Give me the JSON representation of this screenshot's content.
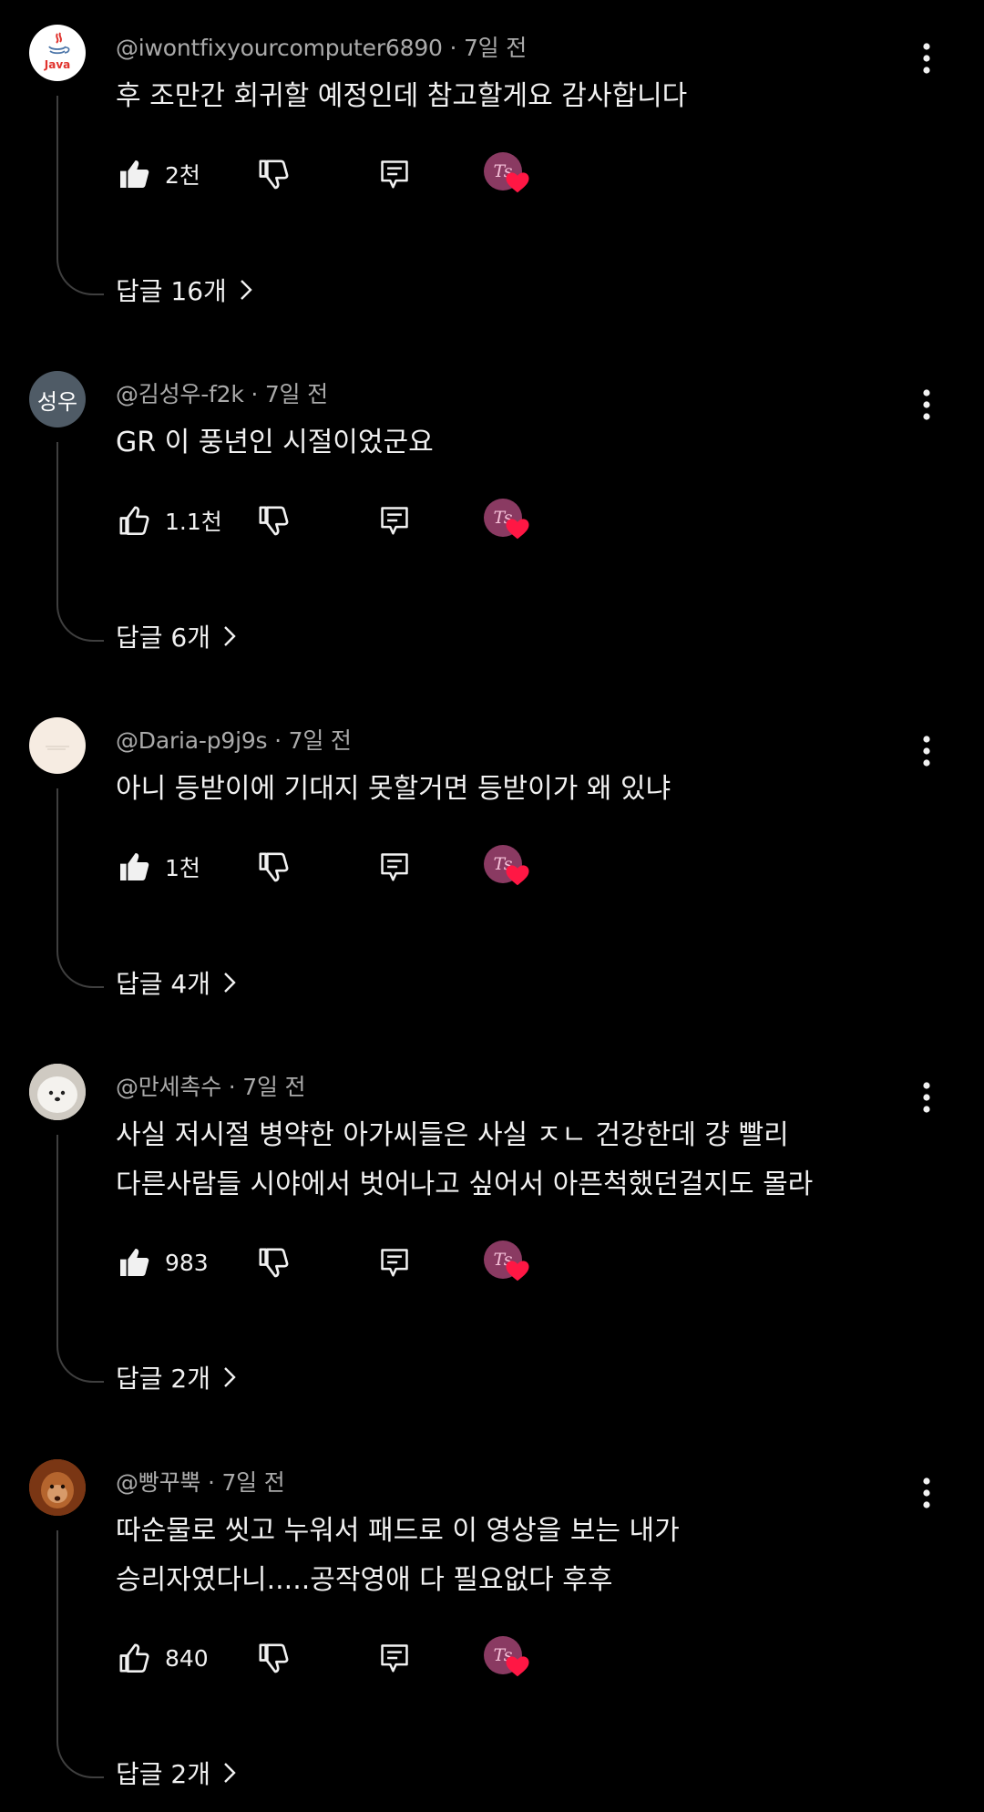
{
  "comments": [
    {
      "author": "@iwontfixyourcomputer6890",
      "time": "· 7일 전",
      "lines": [
        "후 조만간 회귀할 예정인데 참고할게요 감사합니다"
      ],
      "likes": "2천",
      "liked": true,
      "replies": "답글 16개",
      "avatar": {
        "type": "java-logo",
        "caption": "Java"
      }
    },
    {
      "author": "@김성우-f2k",
      "time": "· 7일 전",
      "lines": [
        "GR 이 풍년인 시절이었군요"
      ],
      "likes": "1.1천",
      "liked": false,
      "replies": "답글 6개",
      "avatar": {
        "type": "initials",
        "initials": "성우",
        "color": "#4f5b66"
      }
    },
    {
      "author": "@Daria-p9j9s",
      "time": "· 7일 전",
      "lines": [
        "아니 등받이에 기대지 못할거면 등받이가 왜 있냐"
      ],
      "likes": "1천",
      "liked": true,
      "replies": "답글 4개",
      "avatar": {
        "type": "plain",
        "color": "#f6ece2"
      }
    },
    {
      "author": "@만세촉수",
      "time": "· 7일 전",
      "lines": [
        "사실 저시절 병약한 아가씨들은 사실 ㅈㄴ 건강한데 걍 빨리",
        "다른사람들 시야에서 벗어나고 싶어서 아픈척했던걸지도 몰라"
      ],
      "likes": "983",
      "liked": true,
      "replies": "답글 2개",
      "avatar": {
        "type": "photo-dog",
        "color": "#d9d4cc"
      }
    },
    {
      "author": "@빵꾸뿍",
      "time": "· 7일 전",
      "lines": [
        "따순물로 씻고 누워서 패드로 이 영상을 보는 내가",
        "승리자였다니.....공작영애 다 필요없다 후후"
      ],
      "likes": "840",
      "liked": false,
      "replies": "답글 2개",
      "avatar": {
        "type": "photo-orangutan",
        "color": "#9a4a1c"
      }
    }
  ],
  "creator_heart": {
    "avatar_text": "Ts",
    "avatar_color": "#8a3a62",
    "heart_color": "#ff1744"
  },
  "icons": {
    "like": "thumbs-up-icon",
    "dislike": "thumbs-down-icon",
    "reply": "reply-comment-icon",
    "menu": "more-vertical-icon",
    "chevron": "chevron-right-icon"
  }
}
